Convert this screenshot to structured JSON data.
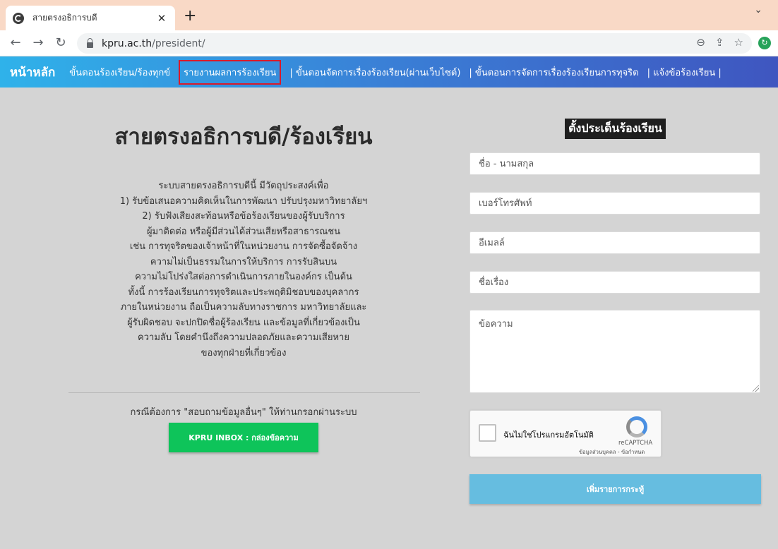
{
  "browser": {
    "tab_title": "สายตรงอธิการบดี",
    "tab_close": "✕",
    "new_tab": "+",
    "url_host": "kpru.ac.th",
    "url_path": "/president/"
  },
  "sitenav": {
    "home": "หน้าหลัก",
    "items": [
      "ขั้นตอนร้องเรียน/ร้องทุกข์",
      "รายงานผลการร้องเรียน",
      "| ขั้นตอนจัดการเรื่องร้องเรียน(ผ่านเว็บไซต์)",
      "| ขั้นตอนการจัดการเรื่องร้องเรียนการทุจริต",
      "| แจ้งข้อร้องเรียน |"
    ]
  },
  "left": {
    "title": "สายตรงอธิการบดี/ร้องเรียน",
    "description": [
      "ระบบสายตรงอธิการบดีนี้ มีวัตถุประสงค์เพื่อ",
      "1) รับข้อเสนอความคิดเห็นในการพัฒนา ปรับปรุงมหาวิทยาลัยฯ",
      "2) รับฟังเสียงสะท้อนหรือข้อร้องเรียนของผู้รับบริการ",
      "ผู้มาติดต่อ หรือผู้มีส่วนได้ส่วนเสียหรือสาธารณชน",
      "เช่น การทุจริตของเจ้าหน้าที่ในหน่วยงาน การจัดซื้อจัดจ้าง",
      "ความไม่เป็นธรรมในการให้บริการ การรับสินบน",
      "ความไม่โปร่งใสต่อการดำเนินการภายในองค์กร เป็นต้น",
      "ทั้งนี้ การร้องเรียนการทุจริตและประพฤติมิชอบของบุคลากร",
      "ภายในหน่วยงาน ถือเป็นความลับทางราชการ มหาวิทยาลัยและ",
      "ผู้รับผิดชอบ จะปกปิดชื่อผู้ร้องเรียน และข้อมูลที่เกี่ยวข้องเป็น",
      "ความลับ โดยคำนึงถึงความปลอดภัยและความเสียหาย",
      "ของทุกฝ่ายที่เกี่ยวข้อง"
    ],
    "inquiry_text": "กรณีต้องการ \"สอบถามข้อมูลอื่นๆ\" ให้ท่านกรอกผ่านระบบ",
    "inbox_button": "KPRU INBOX : กล่องข้อความ"
  },
  "form": {
    "title": "ตั้งประเด็นร้องเรียน",
    "name_placeholder": "ชื่อ - นามสกุล",
    "phone_placeholder": "เบอร์โทรศัพท์",
    "email_placeholder": "อีเมลล์",
    "subject_placeholder": "ชื่อเรื่อง",
    "message_placeholder": "ข้อความ",
    "recaptcha_label": "ฉันไม่ใช่โปรแกรมอัตโนมัติ",
    "recaptcha_brand": "reCAPTCHA",
    "recaptcha_links": "ข้อมูลส่วนบุคคล - ข้อกำหนด",
    "submit_label": "เพิ่มรายการกระทู้"
  },
  "colors": {
    "nav_gradient_start": "#2fb2ea",
    "nav_gradient_end": "#3f56c0",
    "inbox_button": "#0ec45a",
    "submit_button": "#66bde0",
    "active_outline": "#d91a2a"
  }
}
